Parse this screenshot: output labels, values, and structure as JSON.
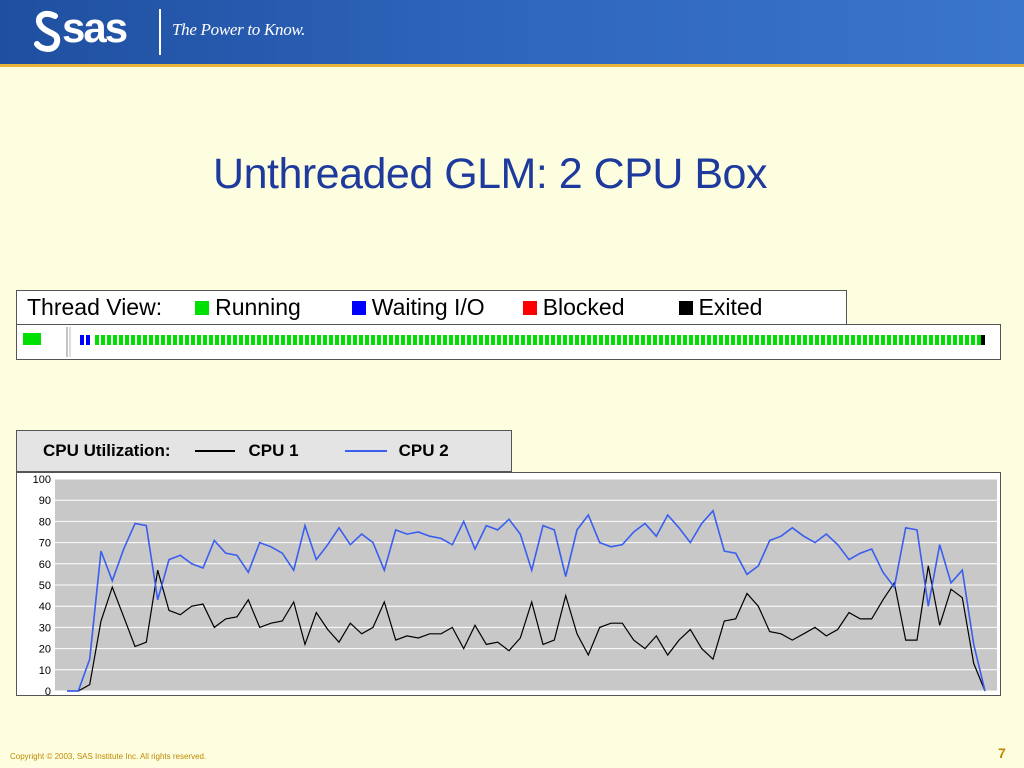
{
  "header": {
    "logo_text": "sas",
    "tagline": "The Power to Know."
  },
  "title": "Unthreaded GLM:  2 CPU Box",
  "thread_legend": {
    "label": "Thread View:",
    "items": [
      {
        "label": "Running",
        "color": "#00e000"
      },
      {
        "label": "Waiting I/O",
        "color": "#0000ff"
      },
      {
        "label": "Blocked",
        "color": "#ff0000"
      },
      {
        "label": "Exited",
        "color": "#000000"
      }
    ]
  },
  "cpu_legend": {
    "label": "CPU Utilization:",
    "items": [
      {
        "label": "CPU 1",
        "color": "#000000"
      },
      {
        "label": "CPU 2",
        "color": "#3a5ef0"
      }
    ]
  },
  "chart_data": {
    "type": "line",
    "title": "",
    "xlabel": "",
    "ylabel": "",
    "ylim": [
      0,
      100
    ],
    "yticks": [
      "0",
      "10",
      "20",
      "30",
      "40",
      "50",
      "60",
      "70",
      "80",
      "90",
      "100"
    ],
    "grid": true,
    "series": [
      {
        "name": "CPU 1",
        "color": "#000000",
        "values": [
          0,
          0,
          3,
          33,
          49,
          35,
          21,
          23,
          57,
          38,
          36,
          40,
          41,
          30,
          34,
          35,
          43,
          30,
          32,
          33,
          42,
          22,
          37,
          29,
          23,
          32,
          27,
          30,
          42,
          24,
          26,
          25,
          27,
          27,
          30,
          20,
          31,
          22,
          23,
          19,
          25,
          42,
          22,
          24,
          45,
          27,
          17,
          30,
          32,
          32,
          24,
          20,
          26,
          17,
          24,
          29,
          20,
          15,
          33,
          34,
          46,
          40,
          28,
          27,
          24,
          27,
          30,
          26,
          29,
          37,
          34,
          34,
          43,
          51,
          24,
          24,
          59,
          31,
          48,
          44,
          13,
          0
        ]
      },
      {
        "name": "CPU 2",
        "color": "#3a5ef0",
        "values": [
          0,
          0,
          15,
          66,
          52,
          67,
          79,
          78,
          43,
          62,
          64,
          60,
          58,
          71,
          65,
          64,
          56,
          70,
          68,
          65,
          57,
          78,
          62,
          69,
          77,
          69,
          74,
          70,
          57,
          76,
          74,
          75,
          73,
          72,
          69,
          80,
          67,
          78,
          76,
          81,
          74,
          57,
          78,
          76,
          54,
          76,
          83,
          70,
          68,
          69,
          75,
          79,
          73,
          83,
          77,
          70,
          79,
          85,
          66,
          65,
          55,
          59,
          71,
          73,
          77,
          73,
          70,
          74,
          69,
          62,
          65,
          67,
          56,
          49,
          77,
          76,
          40,
          69,
          51,
          57,
          22,
          0
        ]
      }
    ]
  },
  "footer": {
    "copyright": "Copyright © 2003, SAS Institute Inc. All rights reserved.",
    "page": "7"
  }
}
